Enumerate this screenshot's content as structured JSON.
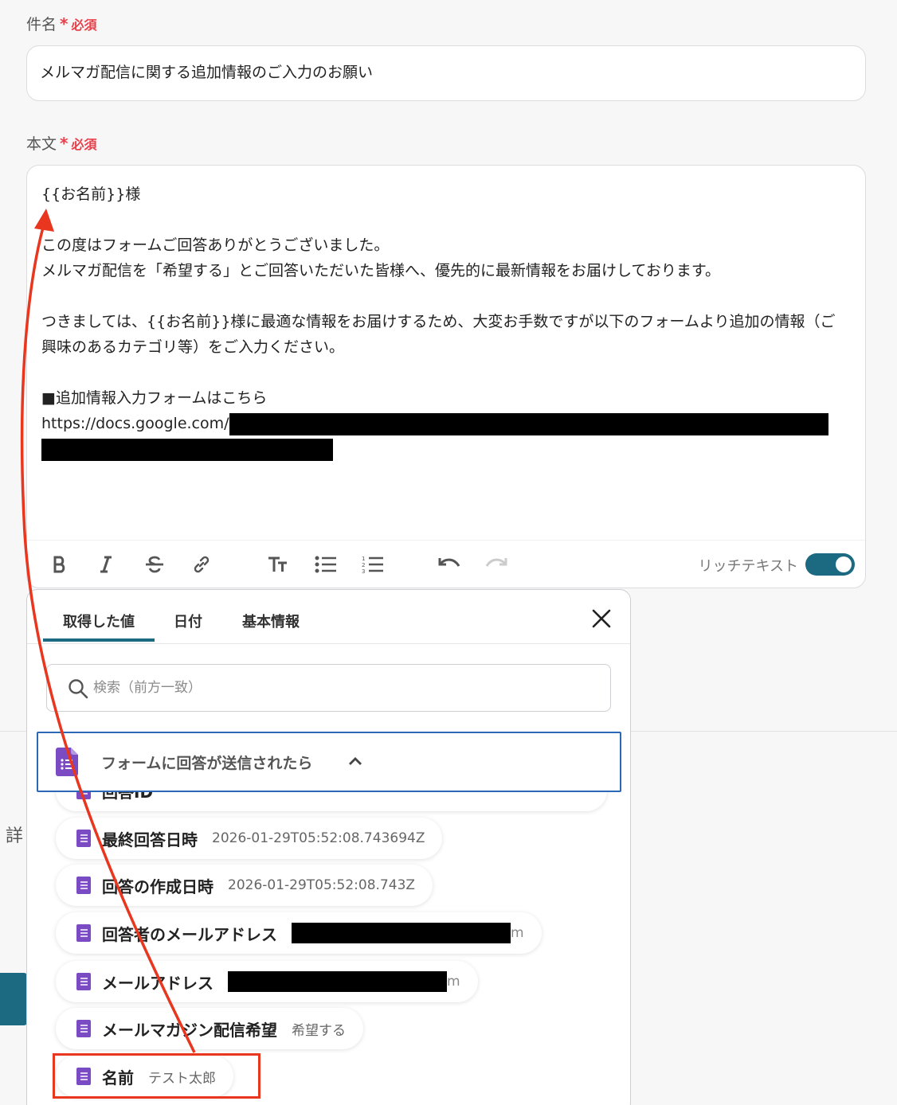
{
  "subject": {
    "label": "件名",
    "required_star": "*",
    "required_text": "必須",
    "value": "メルマガ配信に関する追加情報のご入力のお願い"
  },
  "body": {
    "label": "本文",
    "required_star": "*",
    "required_text": "必須",
    "lines": {
      "l1": "{{お名前}}様",
      "l3": "この度はフォームご回答ありがとうございました。",
      "l4": "メルマガ配信を「希望する」とご回答いただいた皆様へ、優先的に最新情報をお届けしております。",
      "l6": "つきましては、{{お名前}}様に最適な情報をお届けするため、大変お手数ですが以下のフォームより追加の情報（ご興味のあるカテゴリ等）をご入力ください。",
      "l8": "■追加情報入力フォームはこちら",
      "l9": "https://docs.google.com/"
    }
  },
  "toolbar": {
    "rich_text_label": "リッチテキスト",
    "rich_text_on": true
  },
  "background": {
    "side_text": "詳"
  },
  "popup": {
    "tabs": [
      "取得した値",
      "日付",
      "基本情報"
    ],
    "active_tab": "取得した値",
    "search_placeholder": "検索（前方一致）",
    "group_title": "フォームに回答が送信されたら",
    "items": [
      {
        "name": "回答ID",
        "value": ""
      },
      {
        "name": "最終回答日時",
        "value": "2026-01-29T05:52:08.743694Z"
      },
      {
        "name": "回答の作成日時",
        "value": "2026-01-29T05:52:08.743Z"
      },
      {
        "name": "回答者のメールアドレス",
        "value_tail": "m"
      },
      {
        "name": "メールアドレス",
        "value_tail": "m"
      },
      {
        "name": "メールマガジン配信希望",
        "value": "希望する"
      },
      {
        "name": "名前",
        "value": "テスト太郎"
      }
    ]
  },
  "colors": {
    "accent": "#1b6a82",
    "required": "#e8404a",
    "highlight": "#e8361f",
    "forms_purple": "#7b4bc4",
    "group_border": "#2c68b8"
  }
}
